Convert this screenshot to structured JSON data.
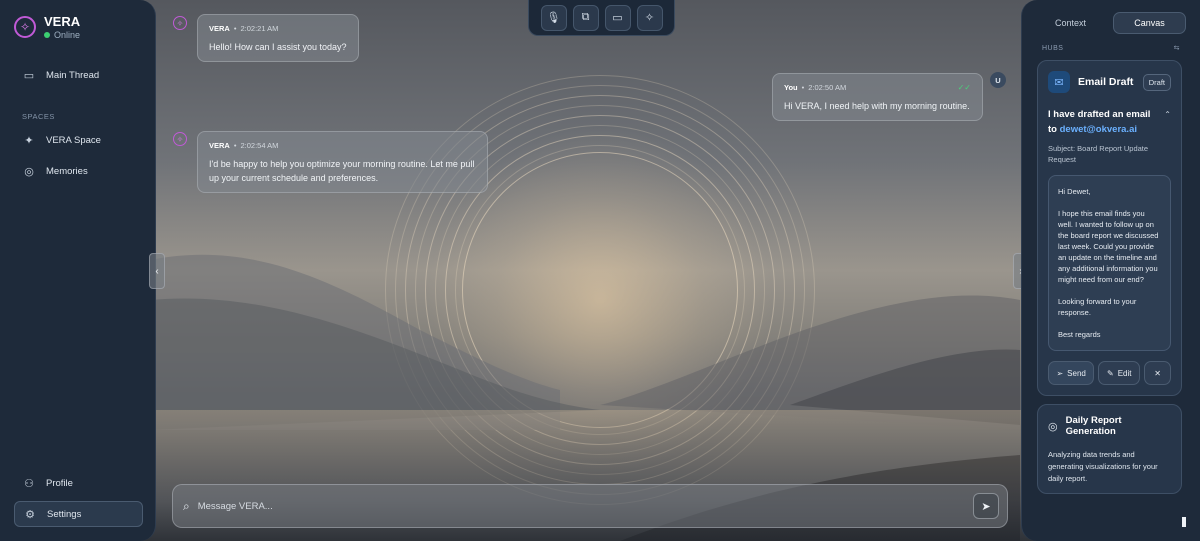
{
  "sidebar": {
    "brand_name": "VERA",
    "status": "Online",
    "main_thread": "Main Thread",
    "spaces_label": "SPACES",
    "items": [
      {
        "label": "VERA Space",
        "icon": "sparkle-icon"
      },
      {
        "label": "Memories",
        "icon": "brain-icon"
      }
    ],
    "profile": "Profile",
    "settings": "Settings"
  },
  "toolbar": {
    "buttons": [
      "microphone-icon",
      "screen-share-icon",
      "monitor-icon",
      "magic-icon"
    ]
  },
  "messages": [
    {
      "sender": "VERA",
      "time": "2:02:21 AM",
      "text": "Hello! How can I assist you today?"
    },
    {
      "sender": "You",
      "time": "2:02:50 AM",
      "text": "Hi VERA, I need help with my morning routine.",
      "user_initial": "U"
    },
    {
      "sender": "VERA",
      "time": "2:02:54 AM",
      "text": "I'd be happy to help you optimize your morning routine. Let me pull up your current schedule and preferences."
    }
  ],
  "composer": {
    "placeholder": "Message VERA..."
  },
  "right_panel": {
    "tabs": [
      "Context",
      "Canvas"
    ],
    "active_tab": "Canvas",
    "hubs_label": "HUBS",
    "email_card": {
      "title": "Email Draft",
      "badge": "Draft",
      "drafted_prefix": "I have drafted an email to",
      "recipient": "dewet@okvera.ai",
      "subject": "Subject: Board Report Update Request",
      "greeting": "Hi Dewet,",
      "body": "I hope this email finds you well. I wanted to follow up on the board report we discussed last week. Could you provide an update on the timeline and any additional information you might need from our end?",
      "closing": "Looking forward to your response.",
      "signoff": "Best regards",
      "send": "Send",
      "edit": "Edit"
    },
    "report_card": {
      "title": "Daily Report Generation",
      "text": "Analyzing data trends and generating visualizations for your daily report."
    }
  },
  "colors": {
    "accent": "#c05ad6",
    "online": "#3ccf72",
    "link": "#6bb1ff",
    "panel": "#1e2a3a"
  }
}
